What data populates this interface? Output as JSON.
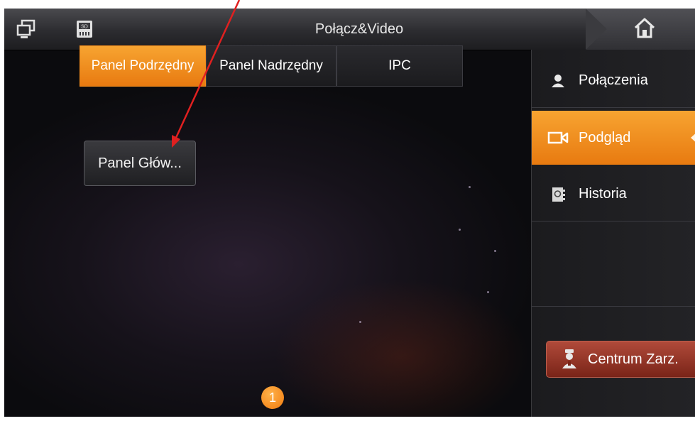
{
  "titlebar": {
    "title": "Połącz&Video",
    "icons": [
      "monitor-icon",
      "sd-card-icon",
      "home-icon"
    ]
  },
  "tabs": [
    {
      "label": "Panel Podrzędny",
      "active": true
    },
    {
      "label": "Panel Nadrzędny",
      "active": false
    },
    {
      "label": "IPC",
      "active": false
    }
  ],
  "devices": [
    {
      "label": "Panel Głów..."
    }
  ],
  "pager": {
    "current": "1"
  },
  "sidebar": {
    "items": [
      {
        "label": "Połączenia",
        "icon": "contact-icon",
        "active": false
      },
      {
        "label": "Podgląd",
        "icon": "camera-icon",
        "active": true
      },
      {
        "label": "Historia",
        "icon": "address-book-icon",
        "active": false
      }
    ],
    "center_button": {
      "label": "Centrum Zarz.",
      "icon": "guard-icon"
    }
  },
  "colors": {
    "accent": "#f08a1c",
    "annotation_arrow": "#e02020",
    "center_button": "#9a3a2a"
  }
}
